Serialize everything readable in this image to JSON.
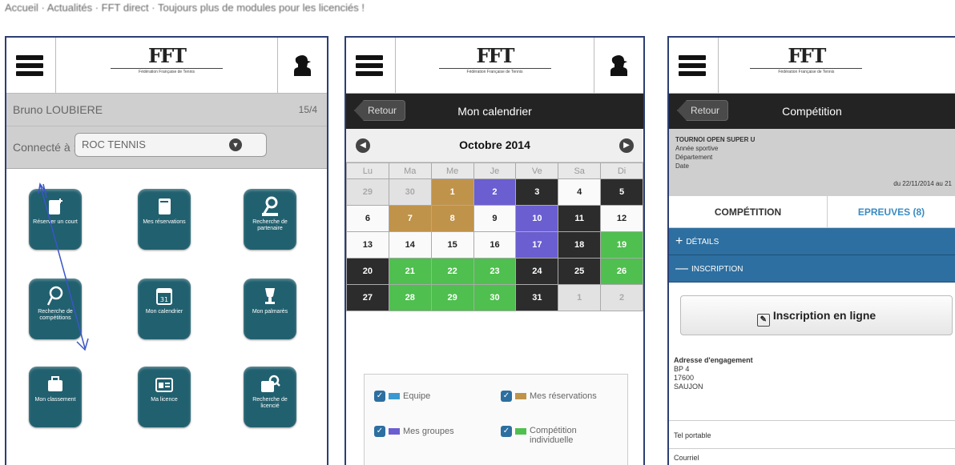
{
  "topline": "Accueil · Actualités · FFT direct · Toujours plus de modules pour les licenciés !",
  "logo": {
    "mark": "FFT",
    "subtitle": "Fédération Française de Tennis"
  },
  "phone1": {
    "user_name": "Bruno LOUBIERE",
    "ratio": "15/4",
    "connect_label": "Connecté à :",
    "club_value": "ROC TENNIS",
    "tiles": [
      {
        "label": "Réserver un court",
        "icon": "court-reservation-icon"
      },
      {
        "label": "Mes réservations",
        "icon": "book-icon"
      },
      {
        "label": "Recherche de partenaire",
        "icon": "partner-search-icon"
      },
      {
        "label": "Recherche de compétitions",
        "icon": "competition-search-icon"
      },
      {
        "label": "Mon calendrier",
        "icon": "calendar-icon"
      },
      {
        "label": "Mon palmarès",
        "icon": "trophy-icon"
      },
      {
        "label": "Mon classement",
        "icon": "ranking-icon"
      },
      {
        "label": "Ma licence",
        "icon": "license-card-icon"
      },
      {
        "label": "Recherche de licencié",
        "icon": "licensee-search-icon"
      }
    ]
  },
  "phone2": {
    "back_label": "Retour",
    "title": "Mon calendrier",
    "month": "Octobre 2014",
    "weekdays": [
      "Lu",
      "Ma",
      "Me",
      "Je",
      "Ve",
      "Sa",
      "Di"
    ],
    "weeks": [
      [
        {
          "d": "29",
          "c": "grey"
        },
        {
          "d": "30",
          "c": "grey"
        },
        {
          "d": "1",
          "c": "gold"
        },
        {
          "d": "2",
          "c": "blue"
        },
        {
          "d": "3",
          "c": "black"
        },
        {
          "d": "4",
          "c": "white"
        },
        {
          "d": "5",
          "c": "black"
        }
      ],
      [
        {
          "d": "6",
          "c": "white"
        },
        {
          "d": "7",
          "c": "gold"
        },
        {
          "d": "8",
          "c": "gold"
        },
        {
          "d": "9",
          "c": "white"
        },
        {
          "d": "10",
          "c": "blue"
        },
        {
          "d": "11",
          "c": "black"
        },
        {
          "d": "12",
          "c": "white"
        }
      ],
      [
        {
          "d": "13",
          "c": "white"
        },
        {
          "d": "14",
          "c": "white"
        },
        {
          "d": "15",
          "c": "white"
        },
        {
          "d": "16",
          "c": "white"
        },
        {
          "d": "17",
          "c": "blue"
        },
        {
          "d": "18",
          "c": "black"
        },
        {
          "d": "19",
          "c": "green"
        }
      ],
      [
        {
          "d": "20",
          "c": "black"
        },
        {
          "d": "21",
          "c": "green"
        },
        {
          "d": "22",
          "c": "green"
        },
        {
          "d": "23",
          "c": "green"
        },
        {
          "d": "24",
          "c": "black"
        },
        {
          "d": "25",
          "c": "black"
        },
        {
          "d": "26",
          "c": "green"
        }
      ],
      [
        {
          "d": "27",
          "c": "black"
        },
        {
          "d": "28",
          "c": "green"
        },
        {
          "d": "29",
          "c": "green"
        },
        {
          "d": "30",
          "c": "green"
        },
        {
          "d": "31",
          "c": "black"
        },
        {
          "d": "1",
          "c": "grey"
        },
        {
          "d": "2",
          "c": "grey"
        }
      ]
    ],
    "legend": [
      {
        "label": "Equipe",
        "color": "#3a9ad0"
      },
      {
        "label": "Mes réservations",
        "color": "#c0934a"
      },
      {
        "label": "Mes groupes",
        "color": "#6a5ed0"
      },
      {
        "label": "Compétition individuelle",
        "color": "#4fbf4f"
      }
    ]
  },
  "phone3": {
    "back_label": "Retour",
    "title": "Compétition",
    "tournament": "TOURNOI OPEN SUPER U",
    "rows": [
      "Année sportive",
      "Département",
      "Date"
    ],
    "date_value": "du 22/11/2014 au 21",
    "tab_competition": "COMPÉTITION",
    "tab_epreuves": "EPREUVES (8)",
    "details": "DÉTAILS",
    "inscription": "INSCRIPTION",
    "inscription_button": "Inscription en ligne",
    "address_title": "Adresse d'engagement",
    "address_lines": [
      "BP 4",
      "17600",
      "SAUJON"
    ],
    "tel_label": "Tel portable",
    "courriel_label": "Courriel"
  },
  "colors": {
    "tile": "#21606f",
    "accent_blue": "#2d6fa0",
    "frame": "#2c3e72"
  }
}
